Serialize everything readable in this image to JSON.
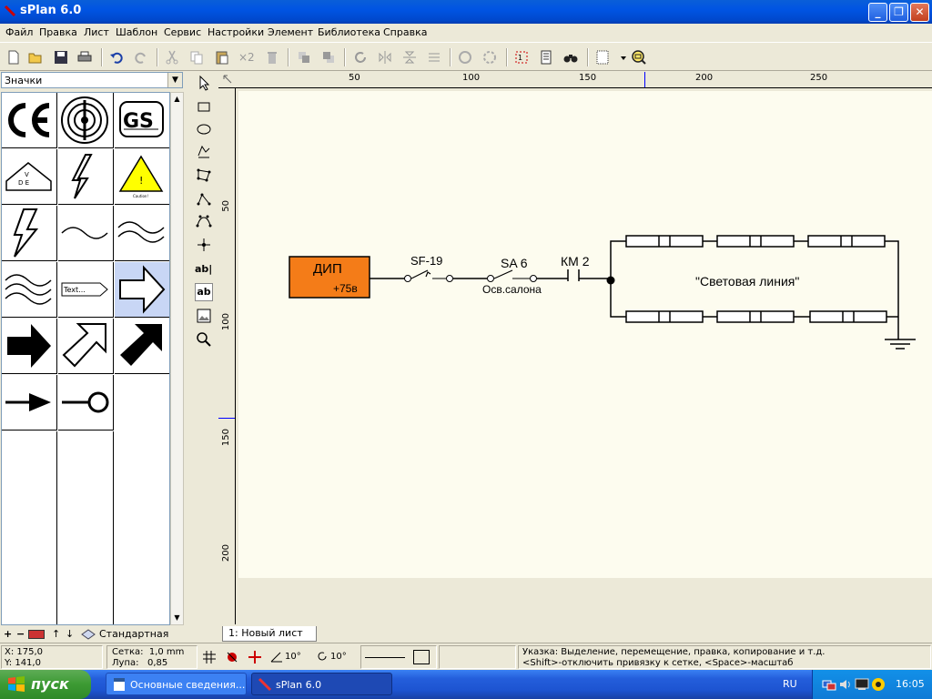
{
  "window": {
    "title": "sPlan 6.0"
  },
  "menu": [
    "Файл",
    "Правка",
    "Лист",
    "Шаблон",
    "Сервис",
    "Настройки",
    "Элемент",
    "Библиотека",
    "Справка"
  ],
  "toolbar": {
    "multiply_label": "×2"
  },
  "library": {
    "selected": "Значки",
    "footer_label": "Стандартная",
    "cells": [
      {
        "icon": "ce-mark-icon"
      },
      {
        "icon": "radiation-symbol-icon"
      },
      {
        "icon": "gs-mark-icon"
      },
      {
        "icon": "vde-mark-icon",
        "text": "V D E"
      },
      {
        "icon": "lightning-bolt-icon"
      },
      {
        "icon": "warning-triangle-icon",
        "text": "Caution!"
      },
      {
        "icon": "lightning-bolt-large-icon"
      },
      {
        "icon": "single-wave-icon"
      },
      {
        "icon": "double-wave-icon"
      },
      {
        "icon": "triple-wave-icon"
      },
      {
        "icon": "text-arrow-label-icon",
        "text": "Text..."
      },
      {
        "icon": "outline-arrow-right-icon"
      },
      {
        "icon": "solid-arrow-right-icon"
      },
      {
        "icon": "outline-arrow-diagonal-icon"
      },
      {
        "icon": "solid-arrow-diagonal-icon"
      },
      {
        "icon": "line-arrow-icon"
      },
      {
        "icon": "line-circle-terminal-icon"
      }
    ]
  },
  "rulers": {
    "horizontal": [
      "50",
      "100",
      "150",
      "200",
      "250"
    ],
    "vertical": [
      "50",
      "100",
      "150",
      "200"
    ]
  },
  "schematic": {
    "power_source_name": "ДИП",
    "power_source_voltage": "+75в",
    "breaker_label": "SF-19",
    "switch_label": "SA 6",
    "switch_caption": "Осв.салона",
    "relay_label": "КМ 2",
    "line_label": "\"Световая линия\""
  },
  "sheet_tab": "1: Новый лист",
  "status": {
    "x": "X: 175,0",
    "y": "Y: 141,0",
    "grid": "Сетка:  1,0 mm",
    "zoom": "Лупа:   0,85",
    "angle1": "10°",
    "angle2": "10°",
    "hint1": "Указка: Выделение, перемещение, правка, копирование и т.д.",
    "hint2": "<Shift>-отключить привязку к сетке, <Space>-масштаб"
  },
  "taskbar": {
    "start": "пуск",
    "items": [
      "Основные сведения...",
      "sPlan 6.0"
    ],
    "lang": "RU",
    "time": "16:05"
  },
  "colors": {
    "power_source_fill": "#f47c18",
    "sheet_bg": "#fdfcef",
    "titlebar": "#0054e3"
  }
}
